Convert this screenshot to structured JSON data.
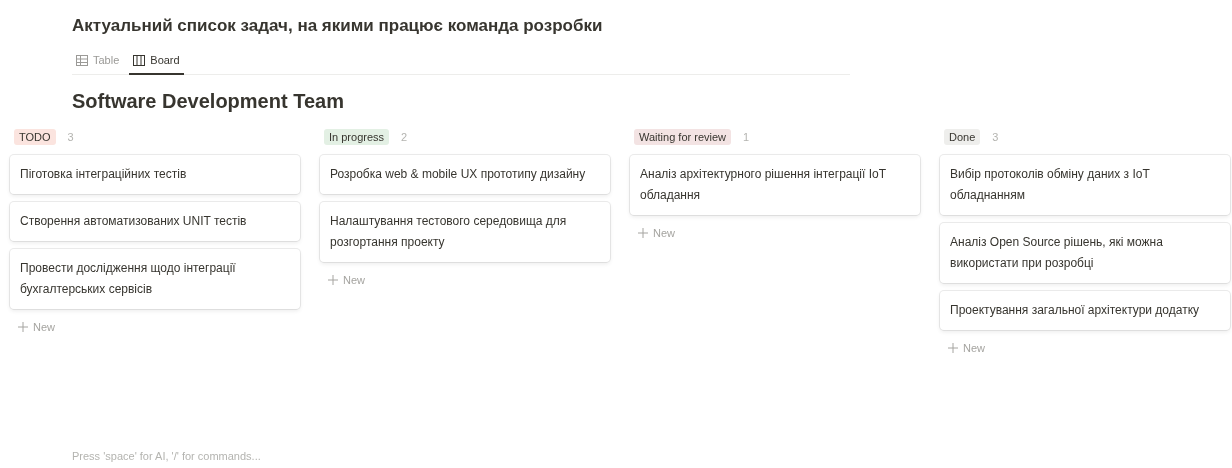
{
  "page": {
    "title": "Актуальний список задач, на якими працює команда розробки"
  },
  "views": [
    {
      "label": "Table",
      "kind": "table",
      "selected": false
    },
    {
      "label": "Board",
      "kind": "board",
      "selected": true
    }
  ],
  "board": {
    "title": "Software Development Team",
    "columns": [
      {
        "name": "TODO",
        "color": "#fbe4df",
        "count": "3",
        "cards": [
          "Пiготовка iнтеграцiйних тестiв",
          "Створення автоматизованих UNIT тестiв",
          "Провести дослiдження щодо iнтеграцiї бухгалтерських сервiсiв"
        ],
        "new_label": "New"
      },
      {
        "name": "In progress",
        "color": "#e3f0e4",
        "count": "2",
        "cards": [
          "Розробка web & mobile UX прототипу дизайну",
          "Налаштування тестового середовища для розгортання проекту"
        ],
        "new_label": "New"
      },
      {
        "name": "Waiting for review",
        "color": "#f3e3e3",
        "count": "1",
        "cards": [
          "Аналiз архiтектурного рiшення iнтеграцiї IoT обладання"
        ],
        "new_label": "New"
      },
      {
        "name": "Done",
        "color": "#eeeeec",
        "count": "3",
        "cards": [
          "Вибiр протоколiв обмiну даних з IoT обладнанням",
          "Аналiз Open Source рiшень, якi можна використати при розробцi",
          "Проектування загальної архiтектури додатку"
        ],
        "new_label": "New"
      }
    ]
  },
  "editor": {
    "placeholder": "Press 'space' for AI, '/' for commands..."
  }
}
